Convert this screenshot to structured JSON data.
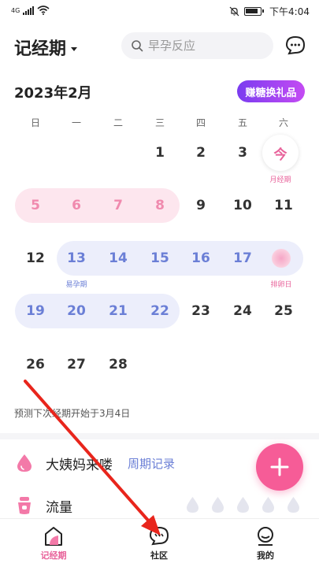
{
  "status_bar": {
    "network": "4G",
    "time": "下午4:04"
  },
  "header": {
    "title": "记经期",
    "search_placeholder": "早孕反应"
  },
  "calendar": {
    "month_label": "2023年2月",
    "gift_button": "赚糖换礼品",
    "weekdays": [
      "日",
      "一",
      "二",
      "三",
      "四",
      "五",
      "六"
    ],
    "days": [
      {
        "label": "1",
        "col": 3,
        "row": 0,
        "type": "normal"
      },
      {
        "label": "2",
        "col": 4,
        "row": 0,
        "type": "normal"
      },
      {
        "label": "3",
        "col": 5,
        "row": 0,
        "type": "normal"
      },
      {
        "label": "5",
        "col": 0,
        "row": 1,
        "type": "period"
      },
      {
        "label": "6",
        "col": 1,
        "row": 1,
        "type": "period"
      },
      {
        "label": "7",
        "col": 2,
        "row": 1,
        "type": "period"
      },
      {
        "label": "8",
        "col": 3,
        "row": 1,
        "type": "period"
      },
      {
        "label": "9",
        "col": 4,
        "row": 1,
        "type": "normal"
      },
      {
        "label": "10",
        "col": 5,
        "row": 1,
        "type": "normal"
      },
      {
        "label": "11",
        "col": 6,
        "row": 1,
        "type": "normal"
      },
      {
        "label": "12",
        "col": 0,
        "row": 2,
        "type": "normal"
      },
      {
        "label": "13",
        "col": 1,
        "row": 2,
        "type": "fertile"
      },
      {
        "label": "14",
        "col": 2,
        "row": 2,
        "type": "fertile"
      },
      {
        "label": "15",
        "col": 3,
        "row": 2,
        "type": "fertile"
      },
      {
        "label": "16",
        "col": 4,
        "row": 2,
        "type": "fertile"
      },
      {
        "label": "17",
        "col": 5,
        "row": 2,
        "type": "fertile"
      },
      {
        "label": "19",
        "col": 0,
        "row": 3,
        "type": "fertile"
      },
      {
        "label": "20",
        "col": 1,
        "row": 3,
        "type": "fertile"
      },
      {
        "label": "21",
        "col": 2,
        "row": 3,
        "type": "fertile"
      },
      {
        "label": "22",
        "col": 3,
        "row": 3,
        "type": "fertile"
      },
      {
        "label": "23",
        "col": 4,
        "row": 3,
        "type": "normal"
      },
      {
        "label": "24",
        "col": 5,
        "row": 3,
        "type": "normal"
      },
      {
        "label": "25",
        "col": 6,
        "row": 3,
        "type": "normal"
      },
      {
        "label": "26",
        "col": 0,
        "row": 4,
        "type": "normal"
      },
      {
        "label": "27",
        "col": 1,
        "row": 4,
        "type": "normal"
      },
      {
        "label": "28",
        "col": 2,
        "row": 4,
        "type": "normal"
      }
    ],
    "today_label": "今",
    "today_note": "月经期",
    "fertile_note": "易孕期",
    "ovulation_note": "排卵日",
    "prediction": "预测下次经期开始于3月4日"
  },
  "record": {
    "period_label": "大姨妈来喽",
    "cycle_link": "周期记录",
    "flow_label": "流量",
    "flow_level": 0,
    "flow_max": 5
  },
  "tabs": [
    {
      "label": "记经期",
      "active": true
    },
    {
      "label": "社区",
      "active": false
    },
    {
      "label": "我的",
      "active": false
    }
  ],
  "colors": {
    "accent_pink": "#f65c97",
    "period_pink": "#f08aae",
    "fertile_blue": "#6b7fd6",
    "gift_purple": "#7a3cf0"
  }
}
